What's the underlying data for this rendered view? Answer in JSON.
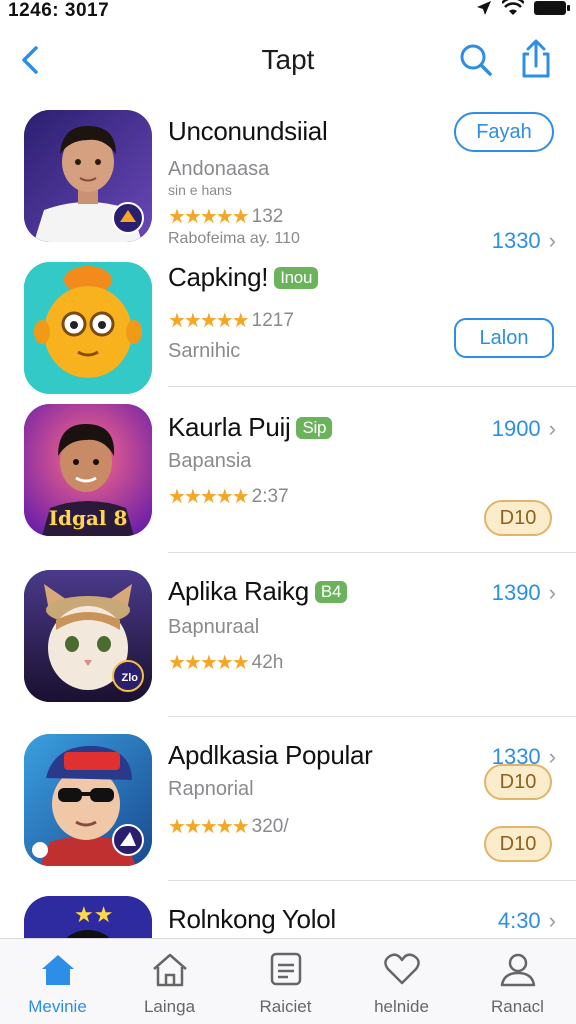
{
  "status_bar": {
    "time": "1246: 3017"
  },
  "nav": {
    "title": "Tapt"
  },
  "apps": [
    {
      "name": "Unconundsiial",
      "subtitle": "Andonaasa",
      "subtitle2": "sin e hans",
      "rating_count": "132",
      "meta": "Rabofeima ay. 110",
      "price": "1330",
      "button": "Fayah"
    },
    {
      "name": "Capking!",
      "tag": "Inou",
      "rating_count": "1217",
      "subtitle": "Sarnihic",
      "button": "Lalon"
    },
    {
      "name": "Kaurla Puij",
      "tag": "Sip",
      "subtitle": "Bapansia",
      "rating_count": "2:37",
      "price": "1900",
      "pill": "D10",
      "badge": "Idgal 8"
    },
    {
      "name": "Aplika Raikg",
      "tag": "B4",
      "subtitle": "Bapnuraal",
      "rating_count": "42h",
      "price": "1390",
      "pill": "D10",
      "badge": "Zlo"
    },
    {
      "name": "Apdlkasia Popular",
      "subtitle": "Rapnorial",
      "rating_count": "320/",
      "price": "1330",
      "pill": "D10"
    },
    {
      "name": "Rolnkong Yolol",
      "price": "4:30"
    }
  ],
  "tabs": [
    {
      "label": "Mevinie",
      "icon": "home-icon"
    },
    {
      "label": "Lainga",
      "icon": "house-outline-icon"
    },
    {
      "label": "Raiciet",
      "icon": "list-icon"
    },
    {
      "label": "helnide",
      "icon": "heart-icon"
    },
    {
      "label": "Ranacl",
      "icon": "person-icon"
    }
  ],
  "colors": {
    "accent": "#2c8ee6",
    "star": "#f5a623",
    "tag": "#6bb35a",
    "pill_bg": "#fbeccb"
  }
}
